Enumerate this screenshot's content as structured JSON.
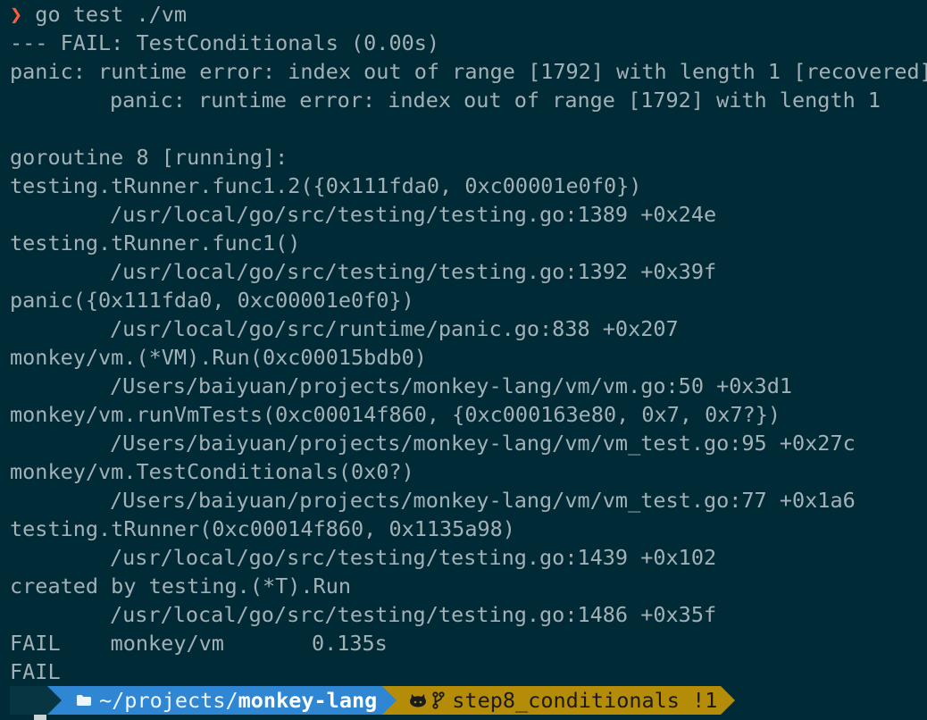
{
  "command": {
    "arrow": "❯",
    "text": " go test ./vm"
  },
  "output": {
    "l1": "--- FAIL: TestConditionals (0.00s)",
    "l2": "panic: runtime error: index out of range [1792] with length 1 [recovered]",
    "l3": "panic: runtime error: index out of range [1792] with length 1",
    "l4": "goroutine 8 [running]:",
    "l5": "testing.tRunner.func1.2({0x111fda0, 0xc00001e0f0})",
    "l6": "/usr/local/go/src/testing/testing.go:1389 +0x24e",
    "l7": "testing.tRunner.func1()",
    "l8": "/usr/local/go/src/testing/testing.go:1392 +0x39f",
    "l9": "panic({0x111fda0, 0xc00001e0f0})",
    "l10": "/usr/local/go/src/runtime/panic.go:838 +0x207",
    "l11": "monkey/vm.(*VM).Run(0xc00015bdb0)",
    "l12": "/Users/baiyuan/projects/monkey-lang/vm/vm.go:50 +0x3d1",
    "l13": "monkey/vm.runVmTests(0xc00014f860, {0xc000163e80, 0x7, 0x7?})",
    "l14": "/Users/baiyuan/projects/monkey-lang/vm/vm_test.go:95 +0x27c",
    "l15": "monkey/vm.TestConditionals(0x0?)",
    "l16": "/Users/baiyuan/projects/monkey-lang/vm/vm_test.go:77 +0x1a6",
    "l17": "testing.tRunner(0xc00014f860, 0x1135a98)",
    "l18": "/usr/local/go/src/testing/testing.go:1439 +0x102",
    "l19": "created by testing.(*T).Run",
    "l20": "/usr/local/go/src/testing/testing.go:1486 +0x35f",
    "summary": {
      "status": "FAIL",
      "package": "monkey/vm",
      "duration": "0.135s"
    },
    "final": "FAIL"
  },
  "prompt": {
    "dir_prefix": "~/projects/",
    "dir_name": "monkey-lang",
    "branch": "step8_conditionals !1"
  },
  "colors": {
    "background": "#002b36",
    "text": "#a3b1b6",
    "prompt_arrow": "#ff5a3a",
    "segment_os": "#073642",
    "segment_dir": "#2f86d2",
    "segment_git": "#b58c08"
  },
  "icons": {
    "os": "apple-icon",
    "dir": "folder-icon",
    "git_host": "github-icon",
    "branch": "git-branch-icon"
  }
}
